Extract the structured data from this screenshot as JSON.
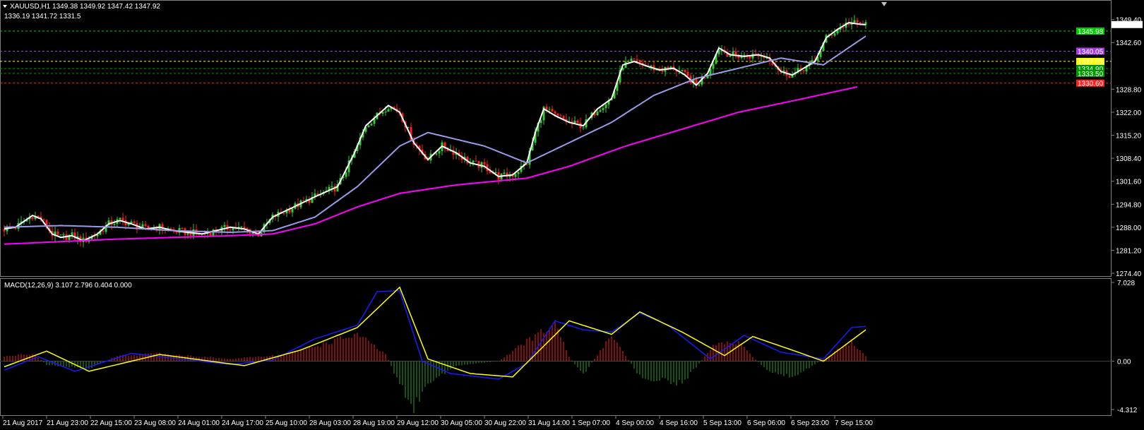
{
  "colors": {
    "background": "#000000",
    "grid": "#808080",
    "bull_candle": "#32cd32",
    "bear_candle": "#ff2020",
    "ma_fast": "#ffffff",
    "ma_mid": "#9a9ae8",
    "ma_slow": "#ff00ff",
    "macd_line": "#1a1aff",
    "signal_line": "#ffff00",
    "hist_up": "#ff2020",
    "hist_down": "#2aa02a",
    "level_green": "#00cc00",
    "level_purple": "#a040e0",
    "level_yellow": "#ffff00",
    "level_dark_green": "#009900",
    "level_red": "#ff2020"
  },
  "header": {
    "symbol_line": "XAUUSD,H1  1349.38 1349.92 1347.42 1347.92",
    "subline": "1336.19 1341.72 1331.5"
  },
  "macd_header": "MACD(12,26,9) 3.107 2.796 0.404 0.000",
  "chart_data": [
    {
      "type": "candlestick",
      "symbol": "XAUUSD",
      "timeframe": "H1",
      "ylim": [
        1274.4,
        1351.0
      ],
      "y_ticks": [
        "1349.40",
        "1342.60",
        "1328.80",
        "1322.00",
        "1315.20",
        "1308.40",
        "1301.60",
        "1294.80",
        "1288.00",
        "1281.20",
        "1274.40"
      ],
      "last_price_label": "1347.92",
      "x_tick_labels": [
        "21 Aug 2017",
        "21 Aug 23:00",
        "22 Aug 15:00",
        "23 Aug 08:00",
        "24 Aug 01:00",
        "24 Aug 17:00",
        "25 Aug 10:00",
        "28 Aug 03:00",
        "28 Aug 19:00",
        "29 Aug 12:00",
        "30 Aug 05:00",
        "30 Aug 22:00",
        "31 Aug 14:00",
        "1 Sep 07:00",
        "4 Sep 00:00",
        "4 Sep 16:00",
        "5 Sep 13:00",
        "6 Sep 06:00",
        "6 Sep 23:00",
        "7 Sep 15:00"
      ],
      "levels": [
        {
          "price": 1345.98,
          "label": "1345.98",
          "color_key": "level_green"
        },
        {
          "price": 1340.05,
          "label": "1340.05",
          "color_key": "level_purple"
        },
        {
          "price": 1337.03,
          "label": "1337.03",
          "color_key": "level_yellow"
        },
        {
          "price": 1334.9,
          "label": "1334.90",
          "color_key": "level_dark_green"
        },
        {
          "price": 1333.5,
          "label": "1333.50",
          "color_key": "level_dark_green"
        },
        {
          "price": 1330.6,
          "label": "1330.60",
          "color_key": "level_red"
        }
      ],
      "price_path": [
        [
          0,
          1287.5
        ],
        [
          4,
          1288.0
        ],
        [
          10,
          1291.5
        ],
        [
          13,
          1290.5
        ],
        [
          17,
          1286.0
        ],
        [
          20,
          1285.0
        ],
        [
          24,
          1285.5
        ],
        [
          28,
          1284.0
        ],
        [
          33,
          1286.0
        ],
        [
          37,
          1289.0
        ],
        [
          41,
          1290.0
        ],
        [
          45,
          1289.0
        ],
        [
          50,
          1287.5
        ],
        [
          55,
          1288.0
        ],
        [
          60,
          1287.0
        ],
        [
          65,
          1286.5
        ],
        [
          70,
          1286.0
        ],
        [
          75,
          1287.0
        ],
        [
          80,
          1288.0
        ],
        [
          85,
          1287.5
        ],
        [
          90,
          1286.0
        ],
        [
          95,
          1291.0
        ],
        [
          100,
          1293.0
        ],
        [
          110,
          1297.0
        ],
        [
          118,
          1300.0
        ],
        [
          124,
          1310.0
        ],
        [
          128,
          1318.0
        ],
        [
          132,
          1321.0
        ],
        [
          136,
          1324.0
        ],
        [
          140,
          1322.0
        ],
        [
          145,
          1313.0
        ],
        [
          150,
          1308.0
        ],
        [
          155,
          1312.0
        ],
        [
          160,
          1310.0
        ],
        [
          165,
          1307.0
        ],
        [
          170,
          1306.0
        ],
        [
          175,
          1303.0
        ],
        [
          180,
          1303.5
        ],
        [
          185,
          1307.0
        ],
        [
          188,
          1316.0
        ],
        [
          191,
          1323.0
        ],
        [
          195,
          1321.0
        ],
        [
          200,
          1319.0
        ],
        [
          205,
          1318.0
        ],
        [
          210,
          1323.0
        ],
        [
          215,
          1326.0
        ],
        [
          219,
          1336.0
        ],
        [
          223,
          1337.0
        ],
        [
          228,
          1335.5
        ],
        [
          232,
          1334.5
        ],
        [
          237,
          1335.0
        ],
        [
          241,
          1333.0
        ],
        [
          245,
          1330.0
        ],
        [
          249,
          1333.5
        ],
        [
          253,
          1341.0
        ],
        [
          257,
          1339.0
        ],
        [
          262,
          1338.5
        ],
        [
          267,
          1339.0
        ],
        [
          271,
          1338.0
        ],
        [
          275,
          1334.0
        ],
        [
          279,
          1333.0
        ],
        [
          283,
          1335.0
        ],
        [
          287,
          1337.0
        ],
        [
          291,
          1344.0
        ],
        [
          295,
          1346.5
        ],
        [
          299,
          1348.5
        ],
        [
          303,
          1348.0
        ],
        [
          305,
          1347.9
        ]
      ],
      "moving_averages": [
        {
          "color_key": "ma_mid",
          "values": [
            [
              0,
              1288.0
            ],
            [
              20,
              1288.5
            ],
            [
              40,
              1288.0
            ],
            [
              60,
              1287.0
            ],
            [
              80,
              1286.5
            ],
            [
              95,
              1287.0
            ],
            [
              110,
              1291.0
            ],
            [
              125,
              1300.0
            ],
            [
              140,
              1312.0
            ],
            [
              150,
              1316.0
            ],
            [
              170,
              1312.0
            ],
            [
              185,
              1307.0
            ],
            [
              200,
              1313.0
            ],
            [
              215,
              1319.0
            ],
            [
              230,
              1327.0
            ],
            [
              245,
              1332.0
            ],
            [
              260,
              1335.0
            ],
            [
              275,
              1338.0
            ],
            [
              290,
              1336.0
            ],
            [
              305,
              1344.5
            ]
          ]
        },
        {
          "color_key": "ma_slow",
          "values": [
            [
              0,
              1283.0
            ],
            [
              40,
              1284.5
            ],
            [
              80,
              1285.5
            ],
            [
              95,
              1286.0
            ],
            [
              110,
              1289.0
            ],
            [
              125,
              1294.0
            ],
            [
              140,
              1298.0
            ],
            [
              160,
              1300.5
            ],
            [
              185,
              1302.5
            ],
            [
              200,
              1306.0
            ],
            [
              220,
              1312.0
            ],
            [
              240,
              1317.0
            ],
            [
              260,
              1322.0
            ],
            [
              280,
              1325.5
            ],
            [
              302,
              1329.5
            ]
          ]
        }
      ]
    },
    {
      "type": "line",
      "title": "MACD(12,26,9) 3.107 2.796 0.404 0.000",
      "ylim": [
        -4.312,
        7.028
      ],
      "y_ticks": [
        "7.028",
        "0.00",
        "-4.312"
      ],
      "series": [
        {
          "color_key": "macd_line",
          "values": [
            [
              0,
              -0.8
            ],
            [
              12,
              0.4
            ],
            [
              25,
              -0.9
            ],
            [
              45,
              0.7
            ],
            [
              80,
              -0.3
            ],
            [
              95,
              0.1
            ],
            [
              110,
              2.0
            ],
            [
              125,
              3.2
            ],
            [
              132,
              6.2
            ],
            [
              140,
              6.3
            ],
            [
              148,
              0.0
            ],
            [
              158,
              -1.1
            ],
            [
              175,
              -1.6
            ],
            [
              185,
              -0.2
            ],
            [
              195,
              3.6
            ],
            [
              205,
              2.8
            ],
            [
              215,
              2.6
            ],
            [
              225,
              4.3
            ],
            [
              235,
              3.2
            ],
            [
              250,
              0.2
            ],
            [
              262,
              2.3
            ],
            [
              275,
              0.8
            ],
            [
              290,
              0.2
            ],
            [
              300,
              3.0
            ],
            [
              305,
              3.1
            ]
          ]
        },
        {
          "color_key": "signal_line",
          "values": [
            [
              0,
              -0.5
            ],
            [
              15,
              0.9
            ],
            [
              30,
              -0.9
            ],
            [
              55,
              0.6
            ],
            [
              85,
              -0.4
            ],
            [
              105,
              1.0
            ],
            [
              125,
              3.0
            ],
            [
              140,
              6.6
            ],
            [
              150,
              0.2
            ],
            [
              165,
              -1.1
            ],
            [
              180,
              -1.4
            ],
            [
              200,
              3.6
            ],
            [
              215,
              2.4
            ],
            [
              225,
              4.4
            ],
            [
              240,
              2.6
            ],
            [
              255,
              0.5
            ],
            [
              265,
              2.2
            ],
            [
              280,
              0.9
            ],
            [
              290,
              0.0
            ],
            [
              305,
              2.8
            ]
          ]
        }
      ],
      "histogram_path": [
        [
          0,
          0.4
        ],
        [
          10,
          0.7
        ],
        [
          15,
          -0.3
        ],
        [
          30,
          -0.7
        ],
        [
          40,
          0.5
        ],
        [
          55,
          0.7
        ],
        [
          80,
          0.2
        ],
        [
          100,
          0.6
        ],
        [
          125,
          2.4
        ],
        [
          135,
          0.6
        ],
        [
          140,
          -2.0
        ],
        [
          145,
          -4.2
        ],
        [
          150,
          -2.0
        ],
        [
          160,
          -0.4
        ],
        [
          175,
          0.0
        ],
        [
          185,
          1.8
        ],
        [
          195,
          3.2
        ],
        [
          200,
          0.4
        ],
        [
          205,
          -1.2
        ],
        [
          215,
          2.4
        ],
        [
          225,
          -1.4
        ],
        [
          240,
          -2.0
        ],
        [
          252,
          1.6
        ],
        [
          260,
          1.6
        ],
        [
          270,
          -0.8
        ],
        [
          280,
          -1.4
        ],
        [
          290,
          0.2
        ],
        [
          300,
          1.7
        ],
        [
          305,
          0.4
        ]
      ]
    }
  ]
}
